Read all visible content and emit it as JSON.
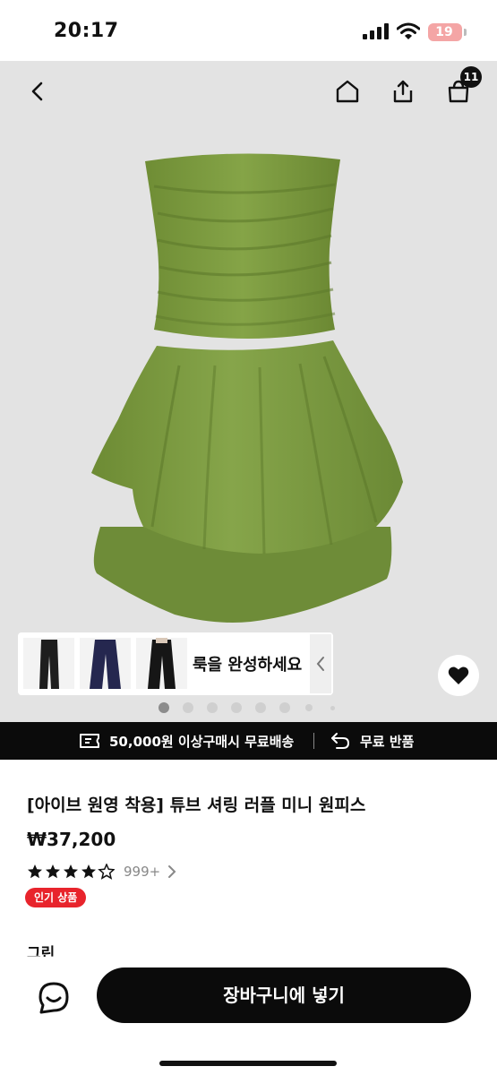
{
  "status_bar": {
    "time": "20:17",
    "battery": "19"
  },
  "header": {
    "cart_count": "11"
  },
  "look_card": {
    "label": "룩을 완성하세요"
  },
  "shipping_banner": {
    "free_shipping": "50,000원 이상구매시 무료배송",
    "free_return": "무료 반품"
  },
  "product": {
    "title": "[아이브 원영 착용] 튜브 셔링 러플 미니 원피스",
    "price": "₩37,200",
    "rating_count": "999+",
    "badge": "인기 상품",
    "color_label": "그린"
  },
  "bottom_bar": {
    "add_to_cart": "장바구니에 넣기"
  },
  "colors": {
    "accent": "#0b0b0b",
    "badge_red": "#e8242c",
    "dress_green": "#7a9a3e"
  },
  "icons": [
    "chevron-left-icon",
    "home-icon",
    "share-icon",
    "shopping-bag-icon",
    "heart-icon",
    "ticket-icon",
    "return-icon",
    "star-icon",
    "chevron-right-icon",
    "chat-icon"
  ]
}
